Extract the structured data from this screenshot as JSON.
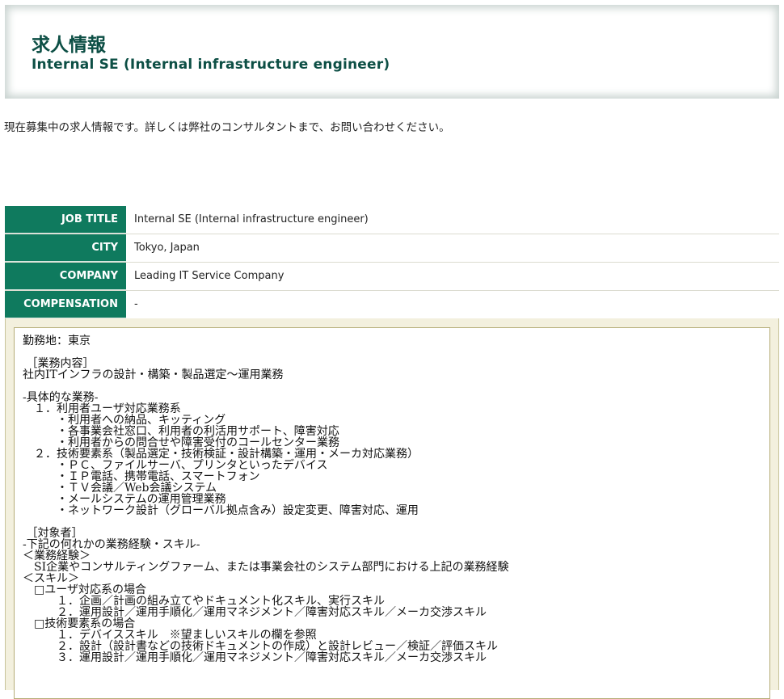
{
  "header": {
    "title": "求人情報",
    "subtitle": "Internal SE (Internal infrastructure engineer)"
  },
  "intro": "現在募集中の求人情報です。詳しくは弊社のコンサルタントまで、お問い合わせください。",
  "details": [
    {
      "label": "JOB TITLE",
      "value": "Internal SE (Internal infrastructure engineer)"
    },
    {
      "label": "CITY",
      "value": "Tokyo, Japan"
    },
    {
      "label": "COMPANY",
      "value": "Leading IT Service Company"
    },
    {
      "label": "COMPENSATION",
      "value": "-"
    }
  ],
  "description": [
    "勤務地：東京",
    "",
    " ［業務内容］",
    "社内ITインフラの設計・構築・製品選定～運用業務",
    "",
    "-具体的な業務-",
    "　１．利用者ユーザ対応業務系",
    "　　　・利用者への納品、キッティング",
    "　　　・各事業会社窓口、利用者の利活用サポート、障害対応",
    "　　　・利用者からの問合せや障害受付のコールセンター業務",
    "　２．技術要素系（製品選定・技術検証・設計構築・運用・メーカ対応業務）",
    "　　　・ＰＣ、ファイルサーバ、プリンタといったデバイス",
    "　　　・ＩＰ電話、携帯電話、スマートフォン",
    "　　　・ＴＶ会議／Web会議システム",
    "　　　・メールシステムの運用管理業務",
    "　　　・ネットワーク設計（グローバル拠点含み）設定変更、障害対応、運用",
    "",
    " ［対象者］",
    "-下記の何れかの業務経験・スキル-",
    "＜業務経験＞",
    "　SI企業やコンサルティングファーム、または事業会社のシステム部門における上記の業務経験",
    "＜スキル＞",
    "　□ユーザ対応系の場合",
    "　　　１．企画／計画の組み立てやドキュメント化スキル、実行スキル",
    "　　　２．運用設計／運用手順化／運用マネジメント／障害対応スキル／メーカ交渉スキル",
    "　□技術要素系の場合",
    "　　　１．デバイススキル　※望ましいスキルの欄を参照",
    "　　　２．設計（設計書などの技術ドキュメントの作成）と設計レビュー／検証／評価スキル",
    "　　　３．運用設計／運用手順化／運用マネジメント／障害対応スキル／メーカ交渉スキル"
  ]
}
